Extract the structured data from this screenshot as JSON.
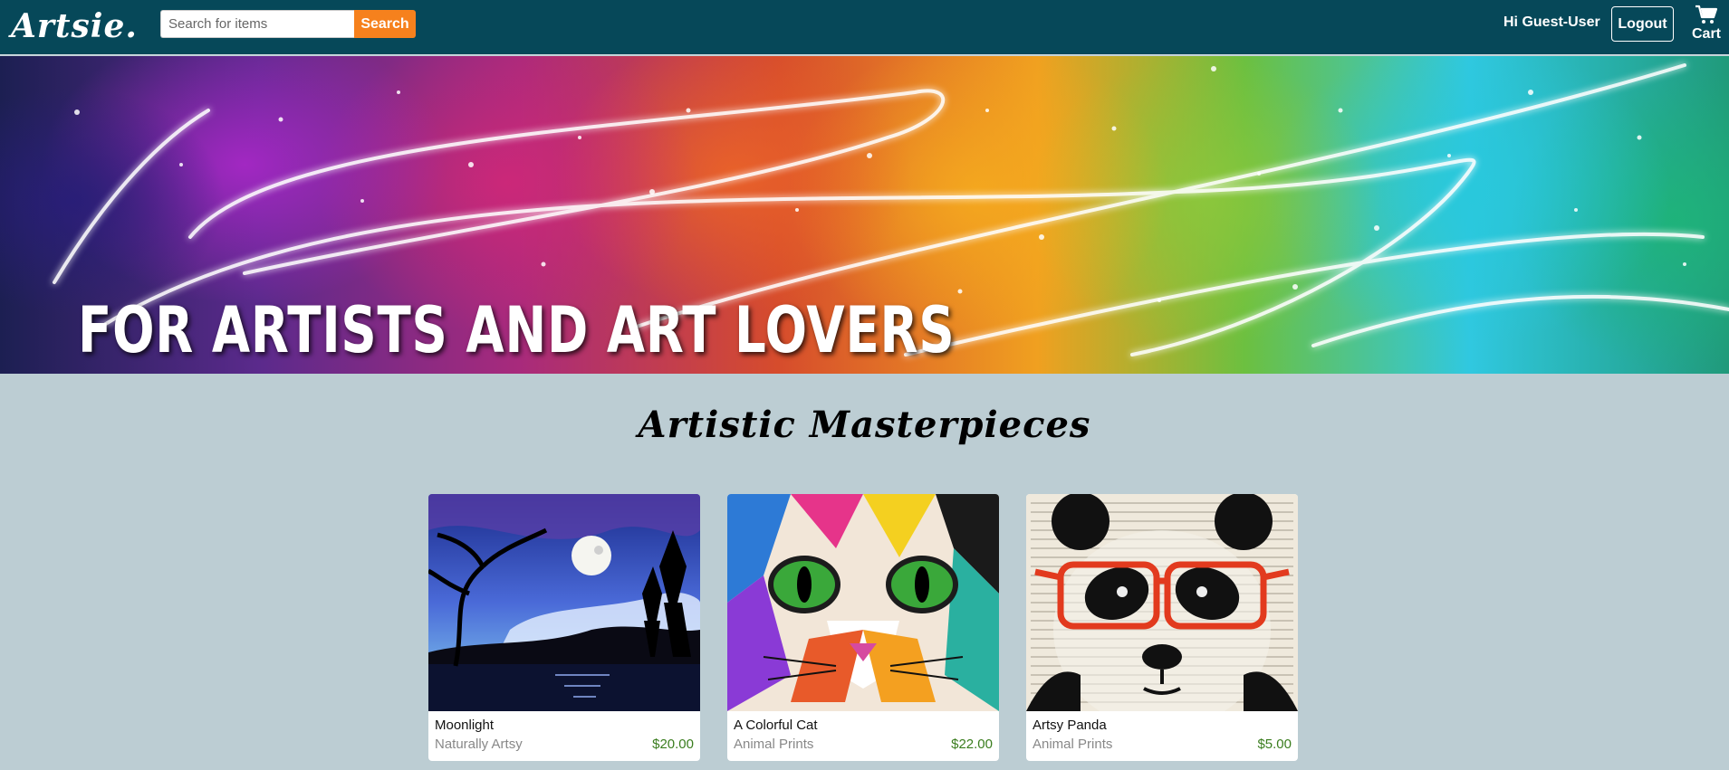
{
  "header": {
    "logo": "Artsie.",
    "search": {
      "placeholder": "Search for items",
      "value": "",
      "button_label": "Search"
    },
    "greeting": "Hi Guest-User",
    "logout_label": "Logout",
    "cart_label": "Cart",
    "colors": {
      "nav_bg": "#064859",
      "search_button": "#f6811d"
    }
  },
  "hero": {
    "title": "FOR ARTISTS AND ART LOVERS"
  },
  "section": {
    "title": "Artistic Masterpieces"
  },
  "products": [
    {
      "name": "Moonlight",
      "category": "Naturally Artsy",
      "price": "$20.00",
      "image": "moonlit-landscape-painting"
    },
    {
      "name": "A Colorful Cat",
      "category": "Animal Prints",
      "price": "$22.00",
      "image": "colorful-cat-painting"
    },
    {
      "name": "Artsy Panda",
      "category": "Animal Prints",
      "price": "$5.00",
      "image": "panda-with-red-glasses-print"
    }
  ]
}
